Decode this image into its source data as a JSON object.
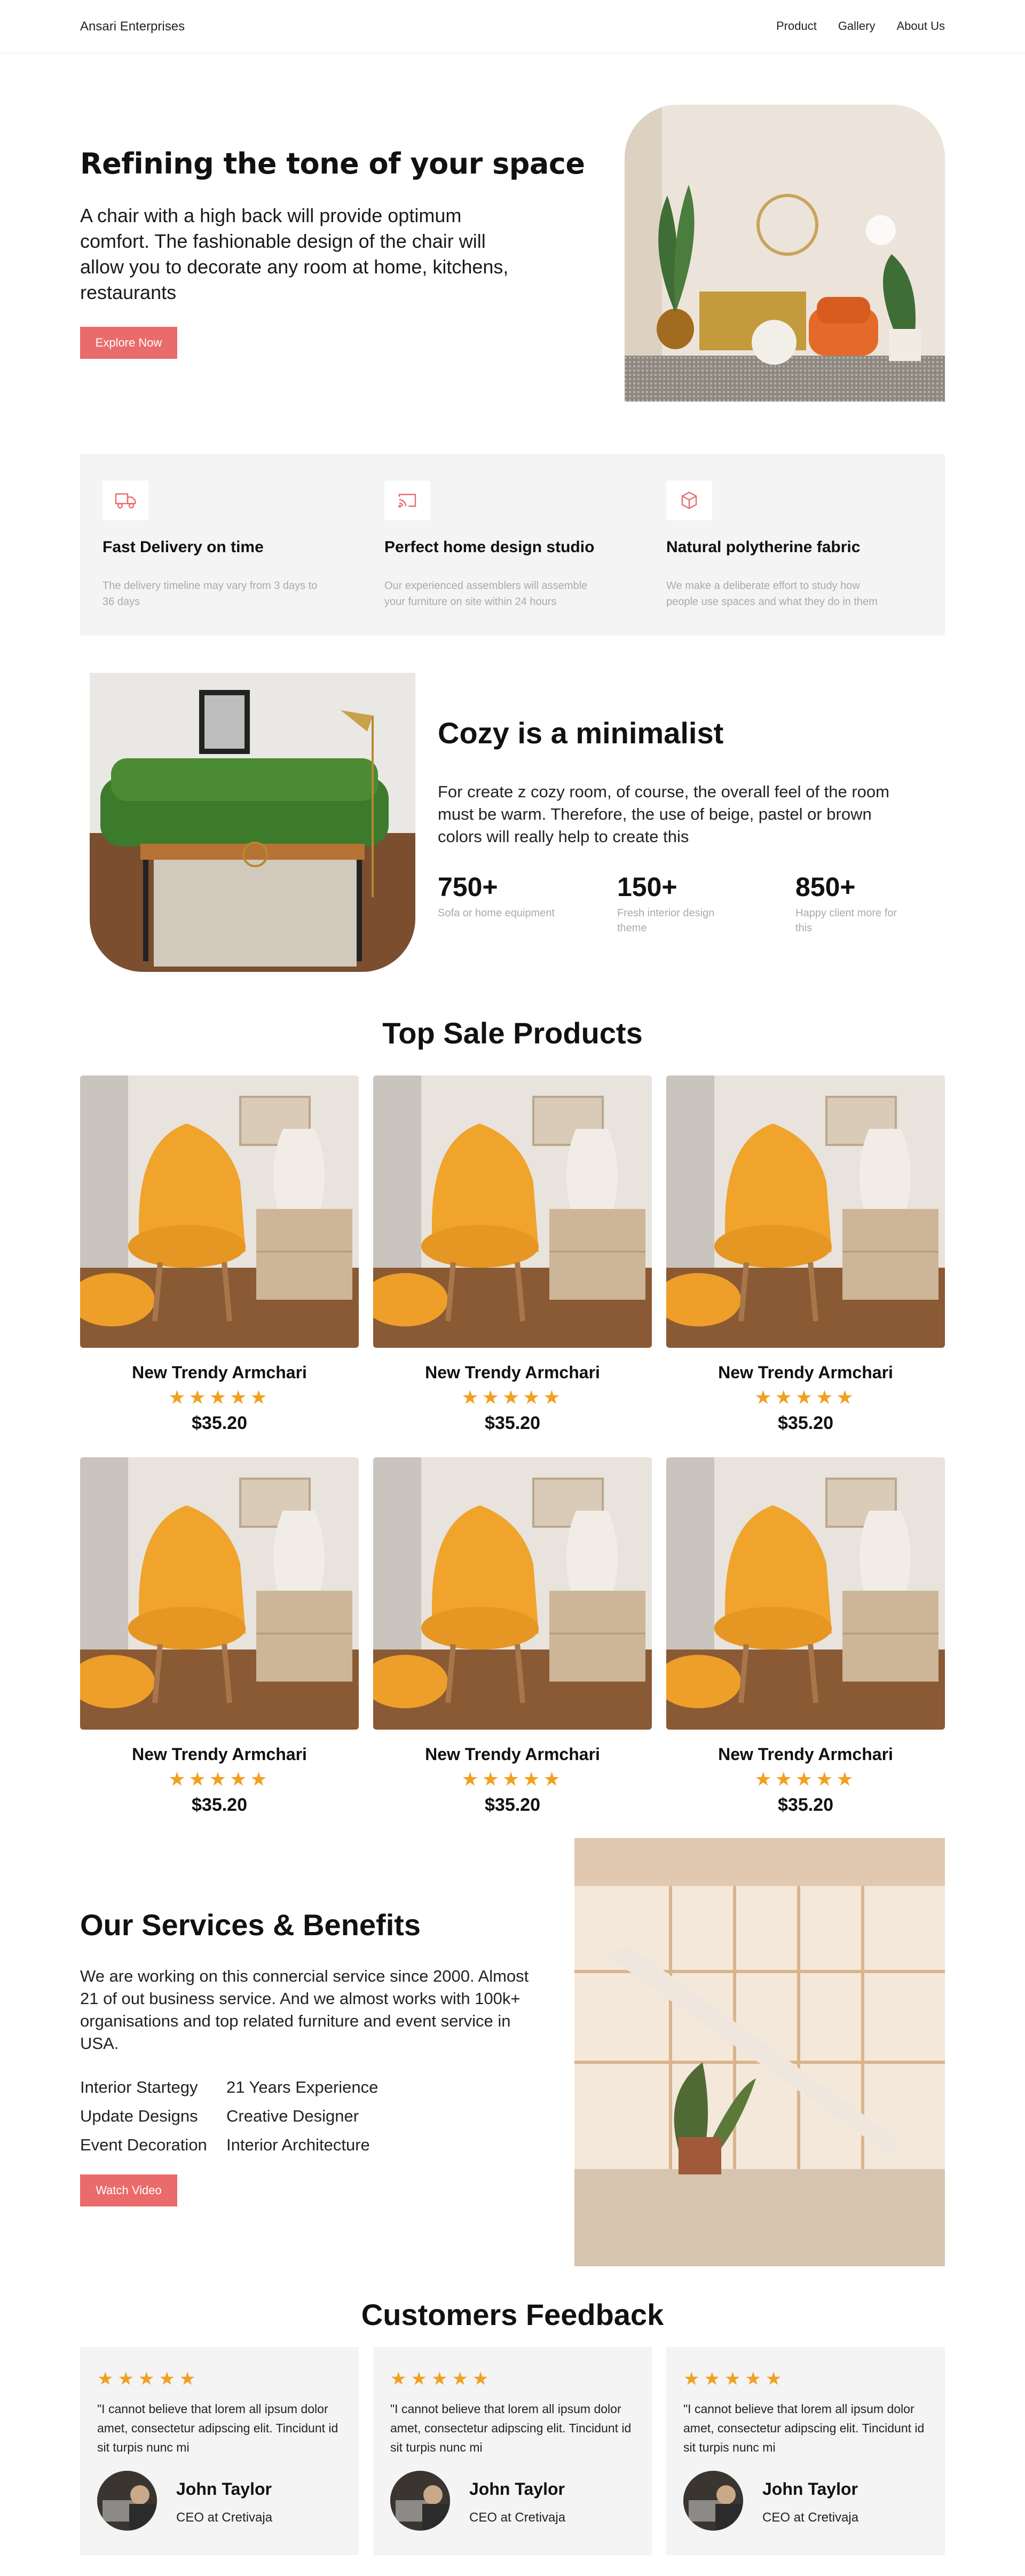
{
  "nav": {
    "brand": "Ansari Enterprises",
    "links": [
      "Product",
      "Gallery",
      "About Us"
    ]
  },
  "hero": {
    "title": "Refining the tone of your space",
    "description": "A chair with a high back will provide optimum comfort. The fashionable design of the chair will allow you to decorate any room at home, kitchens, restaurants",
    "cta": "Explore Now"
  },
  "features": [
    {
      "icon": "truck-icon",
      "title": "Fast Delivery on time",
      "description": "The delivery timeline may vary from 3 days to 36 days"
    },
    {
      "icon": "cast-icon",
      "title": "Perfect home design studio",
      "description": "Our experienced assemblers will assemble your furniture on site within 24 hours"
    },
    {
      "icon": "box-icon",
      "title": "Natural polytherine fabric",
      "description": "We make a deliberate effort to study how people use spaces and what they do in them"
    }
  ],
  "cozy": {
    "title": "Cozy is a minimalist",
    "description": "For create z cozy room, of course, the overall feel of the room must be warm. Therefore, the use of beige, pastel or brown colors will really help to create this",
    "stats": [
      {
        "value": "750+",
        "label": "Sofa or home equipment"
      },
      {
        "value": "150+",
        "label": "Fresh interior design theme"
      },
      {
        "value": "850+",
        "label": "Happy client more for this"
      }
    ]
  },
  "products": {
    "title": "Top Sale Products",
    "items": [
      {
        "name": "New Trendy Armchari",
        "stars": "★★★★★",
        "price": "$35.20"
      },
      {
        "name": "New Trendy Armchari",
        "stars": "★★★★★",
        "price": "$35.20"
      },
      {
        "name": "New Trendy Armchari",
        "stars": "★★★★★",
        "price": "$35.20"
      },
      {
        "name": "New Trendy Armchari",
        "stars": "★★★★★",
        "price": "$35.20"
      },
      {
        "name": "New Trendy Armchari",
        "stars": "★★★★★",
        "price": "$35.20"
      },
      {
        "name": "New Trendy Armchari",
        "stars": "★★★★★",
        "price": "$35.20"
      }
    ]
  },
  "services": {
    "title": "Our Services & Benefits",
    "description": "We are working on this connercial service since 2000. Almost 21 of out business service. And we almost works with 100k+ organisations and top related furniture and event service in USA.",
    "col1": [
      "Interior Startegy",
      "Update Designs",
      "Event Decoration"
    ],
    "col2": [
      "21 Years Experience",
      "Creative Designer",
      "Interior Architecture"
    ],
    "cta": "Watch Video"
  },
  "feedback": {
    "title": "Customers Feedback",
    "items": [
      {
        "stars": "★★★★★",
        "text": "\"I cannot believe that lorem all ipsum dolor amet, consectetur adipscing elit. Tincidunt id sit turpis nunc mi",
        "name": "John Taylor",
        "role": "CEO at Cretivaja"
      },
      {
        "stars": "★★★★★",
        "text": "\"I cannot believe that lorem all ipsum dolor amet, consectetur adipscing elit. Tincidunt id sit turpis nunc mi",
        "name": "John Taylor",
        "role": "CEO at Cretivaja"
      },
      {
        "stars": "★★★★★",
        "text": "\"I cannot believe that lorem all ipsum dolor amet, consectetur adipscing elit. Tincidunt id sit turpis nunc mi",
        "name": "John Taylor",
        "role": "CEO at Cretivaja"
      }
    ]
  },
  "colors": {
    "accent": "#ea6b6b",
    "star": "#f1a01f",
    "panel": "#f4f4f4"
  }
}
